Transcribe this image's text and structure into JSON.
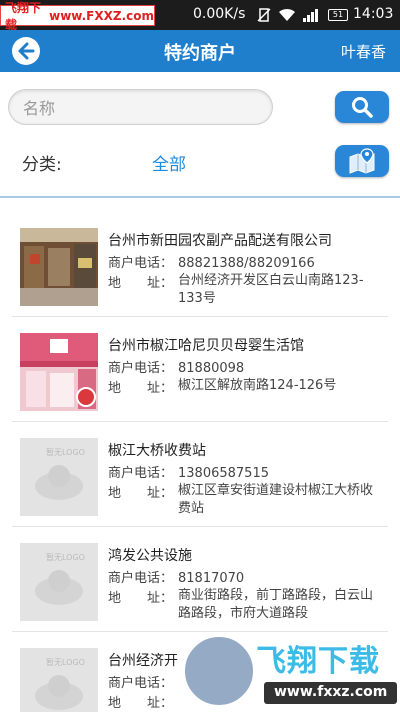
{
  "status_bar": {
    "watermark_site": "飞翔下载",
    "watermark_url": "www.FXXZ.com",
    "speed": "0.00K/s",
    "battery": "51",
    "time": "14:03"
  },
  "header": {
    "title": "特约商户",
    "user": "叶春香"
  },
  "search": {
    "placeholder": "名称"
  },
  "category": {
    "label": "分类:",
    "value": "全部"
  },
  "merchants": [
    {
      "name": "台州市新田园农副产品配送有限公司",
      "phone_label": "商户电话：",
      "phone": "88821388/88209166",
      "addr_label": "地　　址：",
      "address": "台州经济开发区白云山南路123-133号"
    },
    {
      "name": "台州市椒江哈尼贝贝母婴生活馆",
      "phone_label": "商户电话：",
      "phone": "81880098",
      "addr_label": "地　　址：",
      "address": "椒江区解放南路124-126号"
    },
    {
      "name": "椒江大桥收费站",
      "phone_label": "商户电话：",
      "phone": "13806587515",
      "addr_label": "地　　址：",
      "address": "椒江区章安街道建设村椒江大桥收费站"
    },
    {
      "name": "鸿发公共设施",
      "phone_label": "商户电话：",
      "phone": "81817070",
      "addr_label": "地　　址：",
      "address": "商业街路段，前丁路路段，白云山路路段，市府大道路段"
    },
    {
      "name": "台州经济开",
      "phone_label": "商户电话：",
      "phone": "",
      "addr_label": "地　　址：",
      "address": ""
    }
  ],
  "thumb_placeholder_text": "暂无LOGO",
  "watermark": {
    "brand": "飞翔下载",
    "url": "www.fxxz.com"
  },
  "colors": {
    "header_bg": "#1f7fcd",
    "accent_text": "#1d8be0",
    "button_bg": "#2a86d6"
  }
}
